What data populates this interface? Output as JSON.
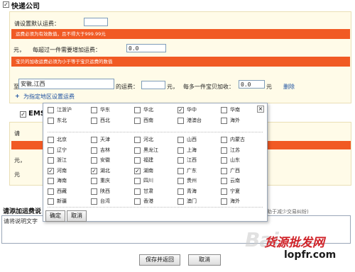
{
  "express": {
    "title": "快递公司",
    "checked": true,
    "default_fee_label": "请设置默认运费：",
    "default_fee_value": "",
    "warn1": "运费必须为有效数值，且不得大于999.99元",
    "unit_yuan": "元，",
    "per_item_label": "每超过一件需要增加运费：",
    "per_item_value": "0.0",
    "warn2": "宝贝的加收运费必须为小于等于宝贝运费的数值",
    "to_label": "至",
    "region_value": "安徽,江西",
    "fee_label": "的运费：",
    "fee_value": "",
    "yuan": "元，",
    "each_extra_label": "每多一件宝贝加收：",
    "each_extra_value": "0.0",
    "yuan2": "元",
    "delete_link": "删除",
    "assign_link": "为指定地区设置运费"
  },
  "ems": {
    "title": "EMS",
    "checked": true,
    "partial1": "请",
    "partial2": "元，",
    "partial3": "元 "
  },
  "note": {
    "label": "请添加运费说",
    "placeholder": "请将说明文字",
    "hint": "助于减少交易纠纷)"
  },
  "popup": {
    "close": "×",
    "groups": [
      [
        "江浙沪",
        "华东",
        "华北",
        "华中",
        "华南"
      ],
      [
        "东北",
        "西北",
        "西南",
        "港澳台",
        "海外"
      ]
    ],
    "group_checked": [
      false,
      false,
      false,
      true,
      false,
      false,
      false,
      false,
      false,
      false
    ],
    "provinces": [
      [
        "北京",
        "天津",
        "河北",
        "山西",
        "内蒙古"
      ],
      [
        "辽宁",
        "吉林",
        "黑龙江",
        "上海",
        "江苏"
      ],
      [
        "浙江",
        "安徽",
        "福建",
        "江西",
        "山东"
      ],
      [
        "河南",
        "湖北",
        "湖南",
        "广东",
        "广西"
      ],
      [
        "海南",
        "重庆",
        "四川",
        "贵州",
        "云南"
      ],
      [
        "西藏",
        "陕西",
        "甘肃",
        "青海",
        "宁夏"
      ],
      [
        "新疆",
        "台湾",
        "香港",
        "澳门",
        "海外"
      ]
    ],
    "province_checked": [
      [
        false,
        false,
        false,
        false,
        false
      ],
      [
        false,
        false,
        false,
        false,
        false
      ],
      [
        false,
        false,
        false,
        false,
        false
      ],
      [
        true,
        true,
        true,
        false,
        false
      ],
      [
        false,
        false,
        false,
        false,
        false
      ],
      [
        false,
        false,
        false,
        false,
        false
      ],
      [
        false,
        false,
        false,
        false,
        false
      ]
    ],
    "confirm": "确定",
    "cancel": "取消"
  },
  "footer": {
    "save": "保存并返回",
    "cancel": "取消"
  },
  "watermark": {
    "baidu": "Bai",
    "site": "货源批发网",
    "url": "lopfr.com"
  }
}
